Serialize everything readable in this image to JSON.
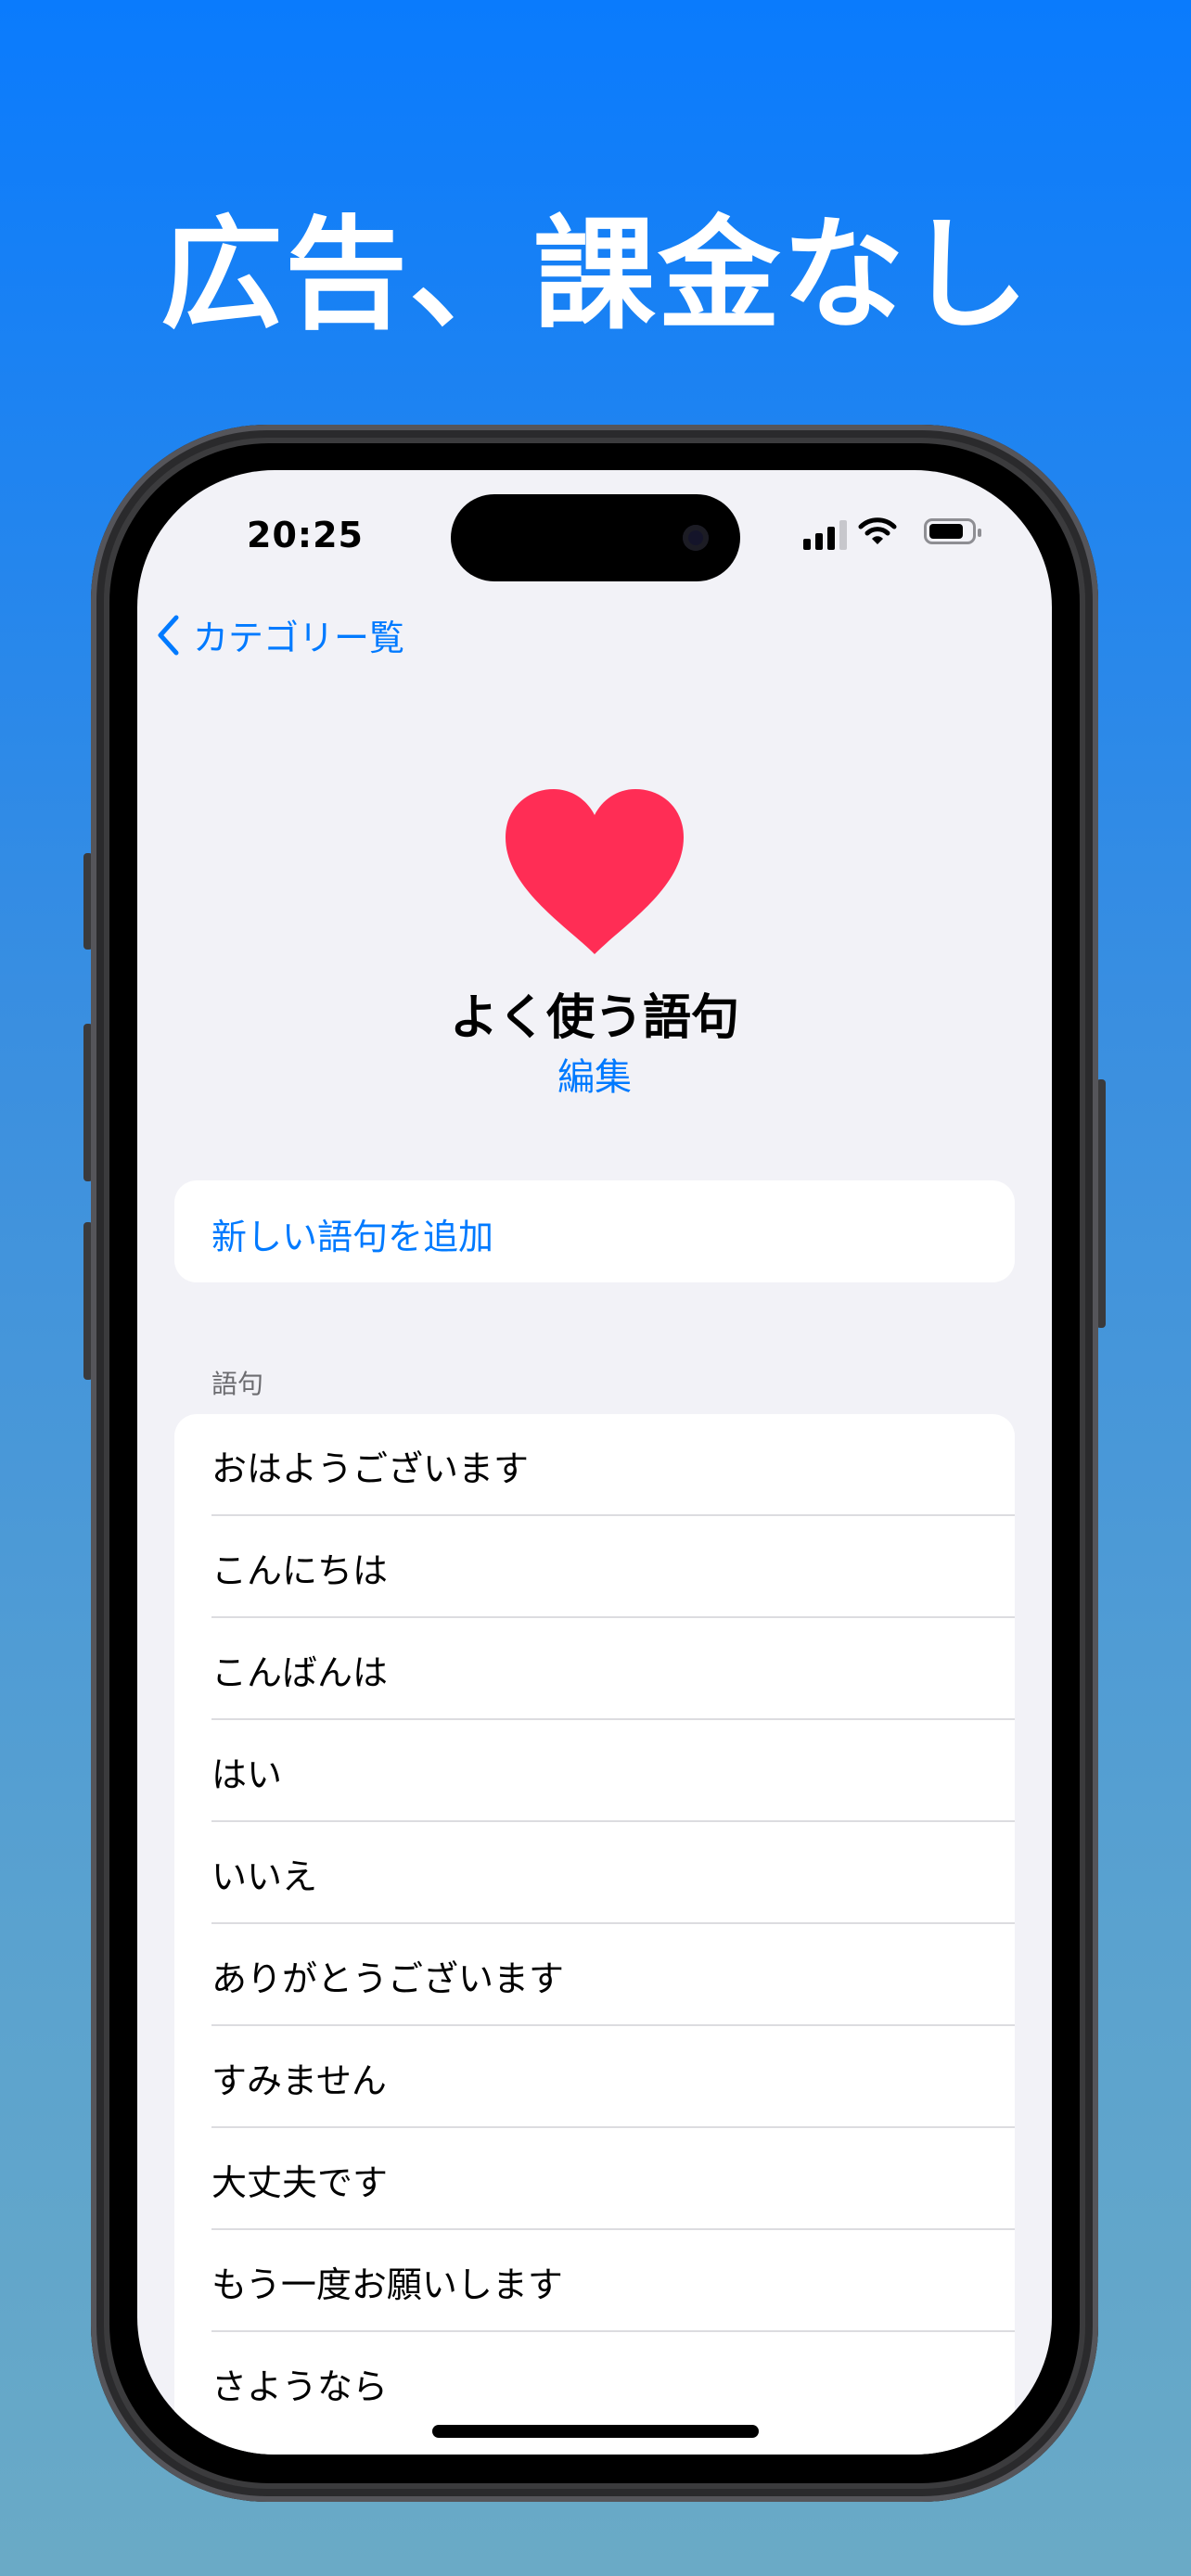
{
  "headline": "広告、課金なし",
  "status_bar": {
    "time": "20:25"
  },
  "nav": {
    "back_label": "カテゴリー覧"
  },
  "category": {
    "icon": "heart-icon",
    "title": "よく使う語句",
    "edit_label": "編集"
  },
  "add_phrase_label": "新しい語句を追加",
  "section_header": "語句",
  "phrases": [
    "おはようございます",
    "こんにちは",
    "こんばんは",
    "はい",
    "いいえ",
    "ありがとうございます",
    "すみません",
    "大丈夫です",
    "もう一度お願いします",
    "さようなら"
  ],
  "colors": {
    "accent": "#007aff",
    "heart": "#ff2d55",
    "background_top": "#0a7bfd",
    "background_bottom": "#6aaac6"
  }
}
